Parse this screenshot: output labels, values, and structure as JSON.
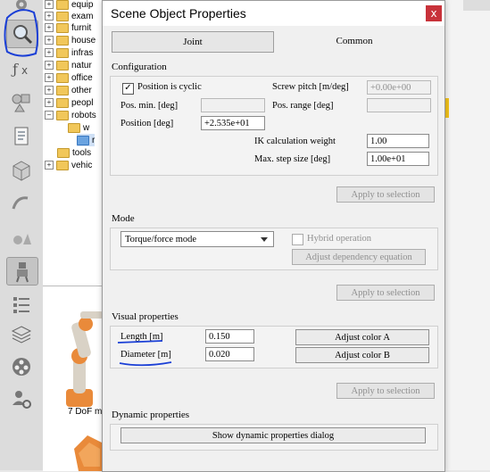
{
  "dialog": {
    "title": "Scene Object Properties",
    "close_label": "x",
    "tabs": [
      {
        "label": "Joint"
      },
      {
        "label": "Common"
      }
    ]
  },
  "tree": {
    "items": [
      {
        "label": "equip",
        "expandable": true,
        "selected": false
      },
      {
        "label": "exam",
        "expandable": true,
        "selected": false
      },
      {
        "label": "furnit",
        "expandable": true,
        "selected": false
      },
      {
        "label": "house",
        "expandable": true,
        "selected": false
      },
      {
        "label": "infras",
        "expandable": true,
        "selected": false
      },
      {
        "label": "natur",
        "expandable": true,
        "selected": false
      },
      {
        "label": "office",
        "expandable": true,
        "selected": false
      },
      {
        "label": "other",
        "expandable": true,
        "selected": false
      },
      {
        "label": "peopl",
        "expandable": true,
        "selected": false
      },
      {
        "label": "robots",
        "expandable": true,
        "selected": false
      },
      {
        "label": "w",
        "expandable": false,
        "selected": false
      },
      {
        "label": "r",
        "expandable": false,
        "selected": true
      },
      {
        "label": "tools",
        "expandable": false,
        "selected": false
      },
      {
        "label": "vehic",
        "expandable": true,
        "selected": false
      }
    ]
  },
  "browser": {
    "model_label": "7 DoF m"
  },
  "configuration": {
    "section_title": "Configuration",
    "cyclic_label": "Position is cyclic",
    "cyclic_checked": true,
    "check_mark": "✓",
    "screw_pitch_label": "Screw pitch [m/deg]",
    "screw_pitch_value": "+0.00e+00",
    "pos_min_label": "Pos. min. [deg]",
    "pos_min_value": "",
    "pos_range_label": "Pos. range [deg]",
    "pos_range_value": "",
    "position_label": "Position [deg]",
    "position_value": "+2.535e+01",
    "ik_weight_label": "IK calculation weight",
    "ik_weight_value": "1.00",
    "max_step_label": "Max. step size [deg]",
    "max_step_value": "1.00e+01",
    "apply_label": "Apply to selection"
  },
  "mode": {
    "section_title": "Mode",
    "selected_mode": "Torque/force mode",
    "hybrid_label": "Hybrid operation",
    "hybrid_checked": false,
    "adjust_dependency_label": "Adjust dependency equation",
    "apply_label": "Apply to selection"
  },
  "visual": {
    "section_title": "Visual properties",
    "length_label": "Length [m]",
    "length_value": "0.150",
    "diameter_label": "Diameter [m]",
    "diameter_value": "0.020",
    "color_a_label": "Adjust color A",
    "color_b_label": "Adjust color B",
    "apply_label": "Apply to selection"
  },
  "dynamic": {
    "section_title": "Dynamic properties",
    "show_dialog_label": "Show dynamic properties dialog"
  },
  "colors": {
    "close_button": "#c8323a",
    "annotation_ink": "#1a3fd6",
    "tree_folder": "#f1c75a",
    "robot_orange": "#e98a3a",
    "accent_yellow": "#f2c21b"
  }
}
